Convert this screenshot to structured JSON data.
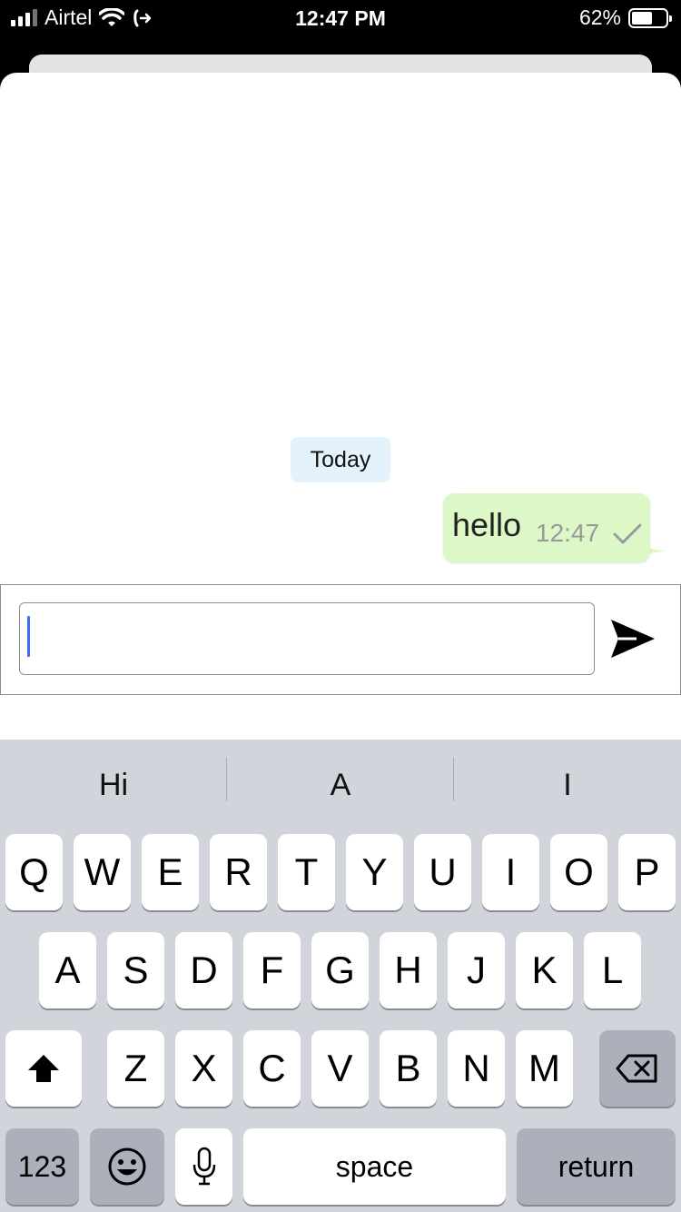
{
  "status_bar": {
    "carrier": "Airtel",
    "time": "12:47 PM",
    "battery_percent_text": "62%",
    "battery_level": 0.62,
    "icons": [
      "signal-icon",
      "wifi-icon",
      "call-forward-icon",
      "battery-icon"
    ]
  },
  "chat": {
    "date_label": "Today",
    "messages": [
      {
        "text": "hello",
        "time": "12:47",
        "status": "sent-check",
        "direction": "outgoing"
      }
    ],
    "bubble_color": "#dcf8c6",
    "date_chip_color": "#e3f2fb"
  },
  "composer": {
    "value": "",
    "placeholder": "",
    "send_icon": "send-icon"
  },
  "keyboard": {
    "suggestions": [
      "Hi",
      "A",
      "I"
    ],
    "row1": [
      "Q",
      "W",
      "E",
      "R",
      "T",
      "Y",
      "U",
      "I",
      "O",
      "P"
    ],
    "row2": [
      "A",
      "S",
      "D",
      "F",
      "G",
      "H",
      "J",
      "K",
      "L"
    ],
    "row3": [
      "Z",
      "X",
      "C",
      "V",
      "B",
      "N",
      "M"
    ],
    "numbers_label": "123",
    "space_label": "space",
    "return_label": "return",
    "icons": [
      "shift-icon",
      "backspace-icon",
      "emoji-icon",
      "microphone-icon"
    ]
  }
}
